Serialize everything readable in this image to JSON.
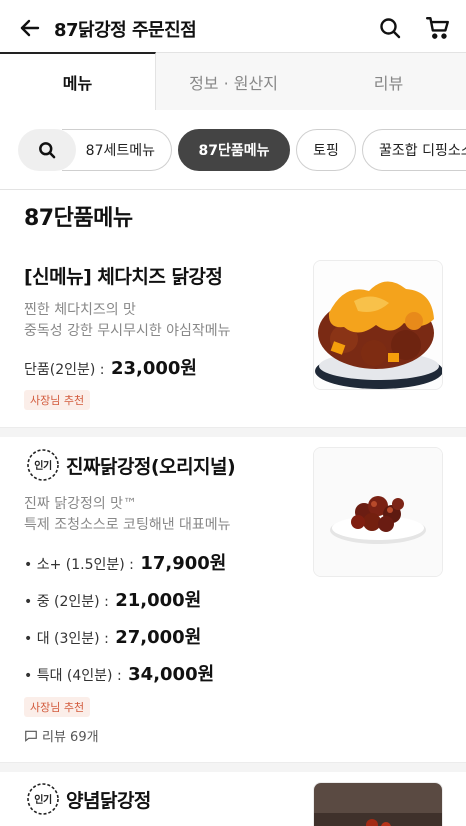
{
  "header": {
    "title": "87닭강정 주문진점"
  },
  "tabs": [
    {
      "label": "메뉴"
    },
    {
      "label": "정보 · 원산지"
    },
    {
      "label": "리뷰"
    }
  ],
  "chips": [
    {
      "label": "87세트메뉴"
    },
    {
      "label": "87단품메뉴"
    },
    {
      "label": "토핑"
    },
    {
      "label": "꿀조합 디핑소스"
    }
  ],
  "section_title": "87단품메뉴",
  "items": [
    {
      "name": "[신메뉴] 체다치즈 닭강정",
      "desc": [
        "찐한 체다치즈의 맛",
        "중독성 강한 무시무시한 야심작메뉴"
      ],
      "prices": [
        {
          "label": "단품(2인분) : ",
          "price": "23,000원"
        }
      ],
      "badge": "사장님 추천"
    },
    {
      "popular": "인기",
      "name": "진짜닭강정(오리지널)",
      "desc": [
        "진짜 닭강정의 맛™",
        "특제 조청소스로 코팅해낸 대표메뉴"
      ],
      "prices": [
        {
          "label": "• 소+ (1.5인분) : ",
          "price": "17,900원"
        },
        {
          "label": "• 중 (2인분) : ",
          "price": "21,000원"
        },
        {
          "label": "• 대 (3인분) : ",
          "price": "27,000원"
        },
        {
          "label": "• 특대 (4인분) : ",
          "price": "34,000원"
        }
      ],
      "badge": "사장님 추천",
      "review": "리뷰 69개"
    },
    {
      "popular": "인기",
      "name": "양념닭강정"
    }
  ],
  "icons": {
    "back": "arrow-left",
    "search": "magnifier",
    "cart": "cart",
    "review": "speech-bubble"
  },
  "colors": {
    "accent": "#444444",
    "badge_text": "#d25a3c",
    "badge_bg": "#fbeee9"
  }
}
